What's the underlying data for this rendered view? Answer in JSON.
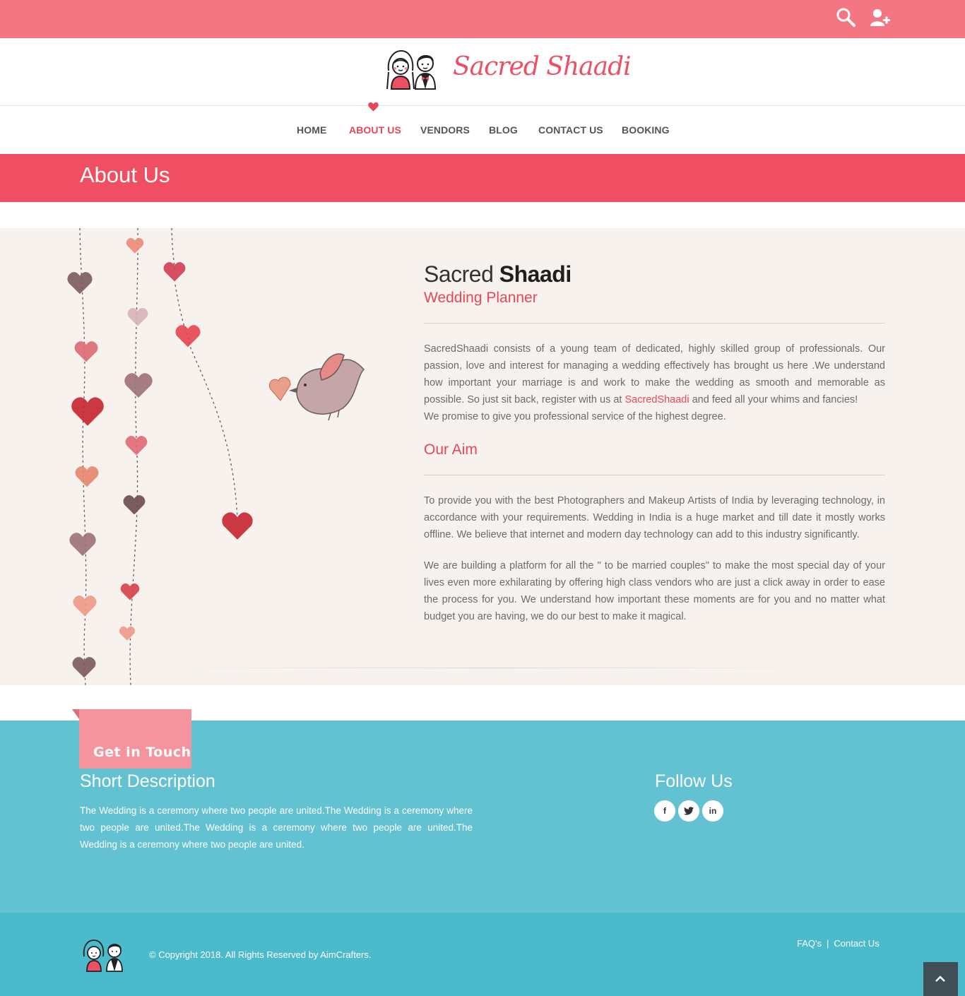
{
  "brand": {
    "name": "Sacred Shaadi",
    "accent_color": "#ef4f63",
    "topbar_color": "#f47683",
    "footer_color": "#63c2d1"
  },
  "topbar": {
    "icons": [
      "search-icon",
      "add-user-icon"
    ]
  },
  "nav": {
    "items": [
      {
        "label": "HOME",
        "active": false
      },
      {
        "label": "ABOUT US",
        "active": true
      },
      {
        "label": "VENDORS",
        "active": false
      },
      {
        "label": "BLOG",
        "active": false
      },
      {
        "label": "CONTACT US",
        "active": false
      },
      {
        "label": "BOOKING",
        "active": false
      }
    ]
  },
  "banner": {
    "title": "About Us"
  },
  "about": {
    "title_light": "Sacred",
    "title_bold": "Shaadi",
    "subtitle": "Wedding Planner",
    "intro_before_link": "SacredShaadi consists of a young team of dedicated, highly skilled group of professionals. Our passion, love and interest for managing a wedding effectively has brought us here .We understand how important your marriage is and work to make the wedding as smooth and memorable as possible. So just sit back, register with us at ",
    "intro_link": "SacredShaadi",
    "intro_after_link": " and feed all your whims and fancies!",
    "intro_line2": "We promise to give you professional service of the highest degree.",
    "aim_heading": "Our Aim",
    "aim_p1": "To provide you with the best Photographers and Makeup Artists of India by leveraging technology, in accordance with your requirements. Wedding in India is a huge market and till date it mostly works offline. We believe that internet and modern day technology can add to this industry significantly.",
    "aim_p2": "We are building a platform for all the \" to be married couples\" to make the most special day of your lives even more exhilarating by offering high class vendors who are just a click away in order to ease the process for you. We understand how important these moments are for you and no matter what budget you are having, we do our best to make it magical."
  },
  "footer": {
    "tab_label": "Get in Touch",
    "short_heading": "Short Description",
    "short_text": "The Wedding is a ceremony where two people are united.The Wedding is a ceremony where two people are united.The Wedding is a ceremony where two people are united.The Wedding is a ceremony where two people are united.",
    "follow_heading": "Follow Us",
    "social": [
      {
        "icon": "facebook-icon",
        "glyph": "f"
      },
      {
        "icon": "twitter-icon",
        "glyph": "t"
      },
      {
        "icon": "linkedin-icon",
        "glyph": "in"
      }
    ]
  },
  "bottom": {
    "copyright": "© Copyright 2018. All Rights Reserved by AimCrafters.",
    "links": [
      "FAQ's",
      "Contact Us"
    ],
    "separator": "|"
  }
}
